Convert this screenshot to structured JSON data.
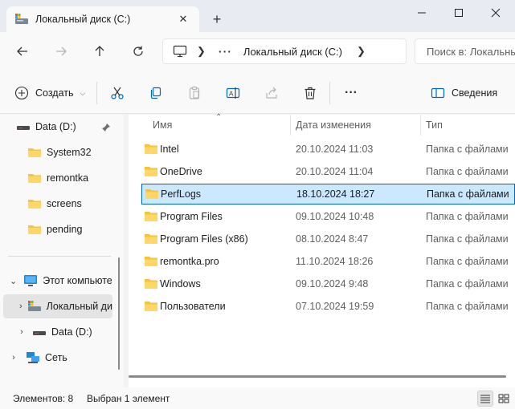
{
  "window": {
    "tab_title": "Локальный диск (C:)",
    "tab_close": "✕",
    "new_tab": "+"
  },
  "nav": {
    "address_more": "···",
    "address_location": "Локальный диск (C:)",
    "search_placeholder": "Поиск в: Локальный диск (C:)"
  },
  "toolbar": {
    "create_label": "Создать",
    "details_label": "Сведения",
    "more_label": "···"
  },
  "sidebar": {
    "items": [
      {
        "label": "Data (D:)",
        "icon": "drive-icon"
      },
      {
        "label": "System32",
        "icon": "folder-icon"
      },
      {
        "label": "remontka",
        "icon": "folder-icon"
      },
      {
        "label": "screens",
        "icon": "folder-icon"
      },
      {
        "label": "pending",
        "icon": "folder-icon"
      },
      {
        "label": "Этот компьютер",
        "icon": "computer-icon"
      },
      {
        "label": "Локальный диск (C:)",
        "icon": "local-disk-icon"
      },
      {
        "label": "Data (D:)",
        "icon": "drive-icon"
      },
      {
        "label": "Сеть",
        "icon": "network-icon"
      }
    ]
  },
  "columns": {
    "name": "Имя",
    "date": "Дата изменения",
    "type": "Тип"
  },
  "files": [
    {
      "name": "Intel",
      "date": "20.10.2024 11:03",
      "type": "Папка с файлами"
    },
    {
      "name": "OneDrive",
      "date": "20.10.2024 11:04",
      "type": "Папка с файлами"
    },
    {
      "name": "PerfLogs",
      "date": "18.10.2024 18:27",
      "type": "Папка с файлами"
    },
    {
      "name": "Program Files",
      "date": "09.10.2024 10:48",
      "type": "Папка с файлами"
    },
    {
      "name": "Program Files (x86)",
      "date": "08.10.2024 8:47",
      "type": "Папка с файлами"
    },
    {
      "name": "remontka.pro",
      "date": "11.10.2024 18:26",
      "type": "Папка с файлами"
    },
    {
      "name": "Windows",
      "date": "09.10.2024 9:48",
      "type": "Папка с файлами"
    },
    {
      "name": "Пользователи",
      "date": "07.10.2024 19:59",
      "type": "Папка с файлами"
    }
  ],
  "status": {
    "count": "Элементов: 8",
    "selected": "Выбран 1 элемент"
  },
  "colors": {
    "folder": "#f5c342",
    "selection_bg": "#cce8ff",
    "selection_border": "#0067c0",
    "accent": "#0067c0"
  }
}
